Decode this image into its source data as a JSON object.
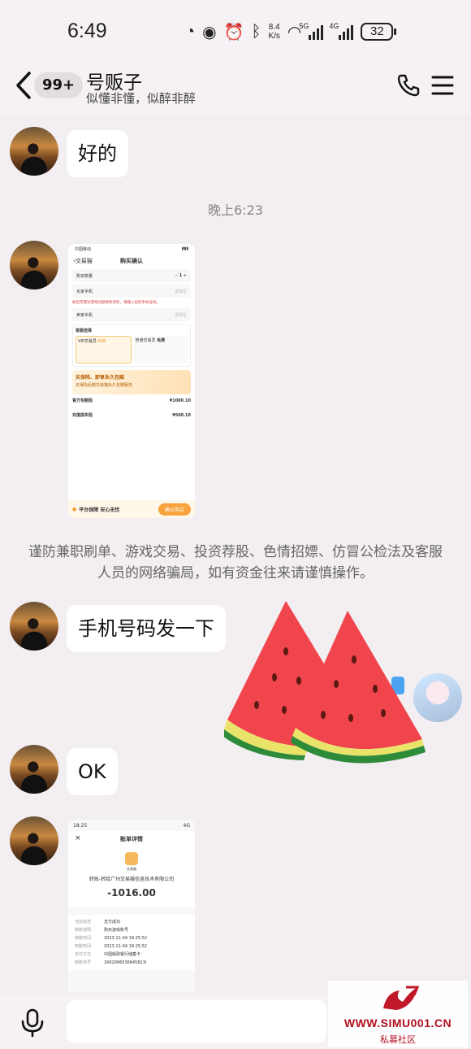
{
  "status_bar": {
    "time": "6:49",
    "speed_value": "8.4",
    "speed_unit": "K/s",
    "network_5g": "5G",
    "network_4g": "4G",
    "battery": "32"
  },
  "header": {
    "unread_badge": "99+",
    "contact_name": "号贩子",
    "contact_signature": "似懂非懂，似醉非醉"
  },
  "messages": {
    "msg1": "好的",
    "time_divider": "晚上6:23",
    "notice": "谨防兼职刷单、游戏交易、投资荐股、色情招嫖、仿冒公检法及客服人员的网络骗局，如有资金往来请谨慎操作。",
    "msg2": "手机号码发一下",
    "msg3": "OK"
  },
  "screenshot1": {
    "carrier": "中国移动",
    "back_label": "交易猫",
    "title": "购买确认",
    "quantity_label": "购买数量",
    "quantity": "1",
    "buyer_phone_label": "买家手机",
    "buyer_phone_placeholder": "请填写",
    "warning": "如您无需对游戏问题修改资料，请输入您的手机号码。",
    "buyer_phone2_label": "卖家手机",
    "service_label": "客服选择",
    "vip_service": "VIP交易员",
    "vip_price": "¥18",
    "normal_service": "普通交易员",
    "normal_price": "免费",
    "promo_title": "买保险、即享永久包赔",
    "promo_sub": "买保险后赠交易猫永久包赔服务",
    "ins_title": "官方包赔险",
    "ins_price": "¥1000.10",
    "ins2_title": "充值损失险",
    "ins2_price": "¥500.10",
    "footer_label": "平台保障 安心无忧",
    "buy_button": "确认购买"
  },
  "screenshot2": {
    "time": "18:25",
    "network": "4G",
    "title": "账单详情",
    "logo_text": "交易猫",
    "merchant": "转账-转给广州交易猫信息技术有限公司",
    "amount": "-1016.00",
    "rows": [
      {
        "k": "当前状态",
        "v": "支付成功"
      },
      {
        "k": "转账说明",
        "v": "购买游戏账号"
      },
      {
        "k": "转账时间",
        "v": "2023-11-04 18:25:52"
      },
      {
        "k": "到账时间",
        "v": "2023-11-04 18:25:52"
      },
      {
        "k": "支付方式",
        "v": "中国邮政银行储蓄卡"
      },
      {
        "k": "转账单号",
        "v": "1662996536845823I"
      }
    ]
  },
  "input": {
    "placeholder": ""
  },
  "watermark": {
    "site": "WWW.SIMU001.CN",
    "name": "私募社区"
  },
  "colors": {
    "background": "#f3eef2",
    "bubble": "#ffffff",
    "watermark": "#b01020",
    "watermelon_flesh": "#f0454c",
    "watermelon_rind": "#2e8b3a"
  }
}
